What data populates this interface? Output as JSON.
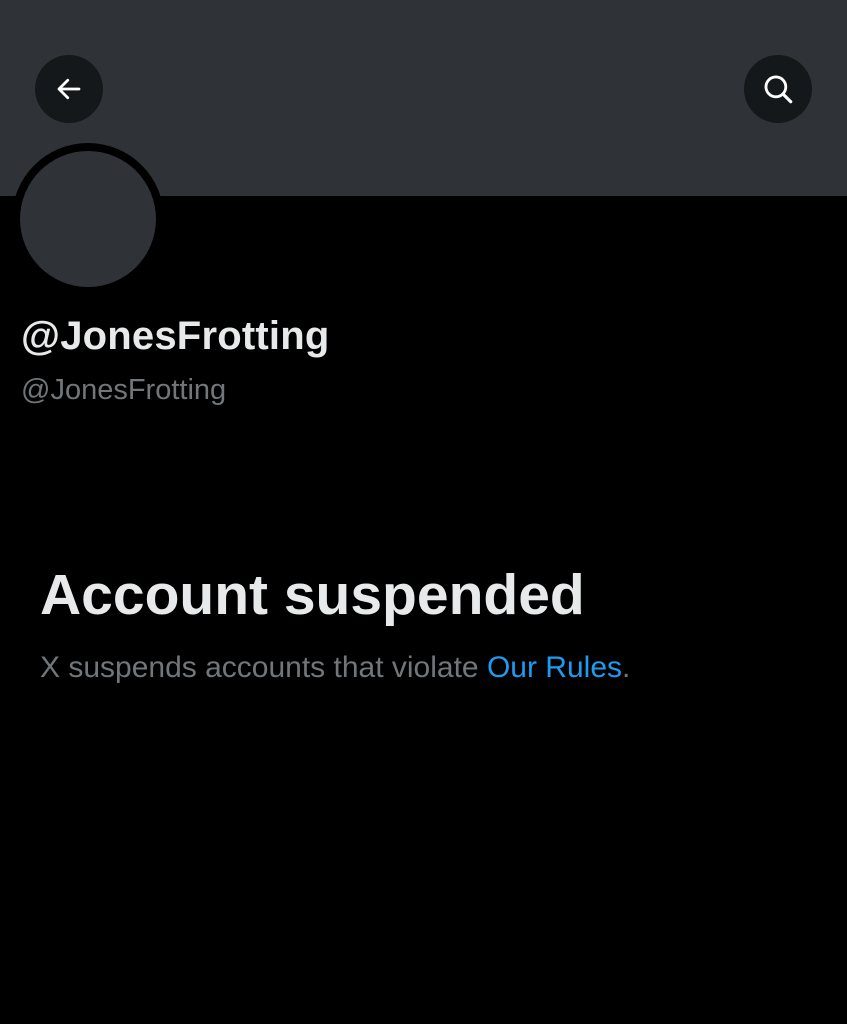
{
  "header": {
    "back_icon": "arrow-left-icon",
    "search_icon": "search-icon"
  },
  "profile": {
    "display_name": "@JonesFrotting",
    "handle": "@JonesFrotting"
  },
  "suspension": {
    "title": "Account suspended",
    "description_prefix": "X suspends accounts that violate ",
    "rules_link": "Our Rules",
    "description_suffix": "."
  },
  "colors": {
    "background": "#000000",
    "banner": "#2f3337",
    "primary_text": "#e7e9ea",
    "secondary_text": "#71767b",
    "link": "#1d9bf0"
  }
}
